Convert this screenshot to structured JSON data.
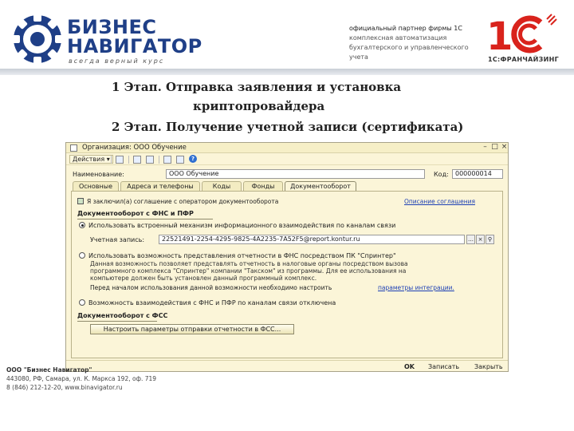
{
  "brand": {
    "line1": "БИЗНЕС",
    "line2": "НАВИГАТОР",
    "tagline": "всегда верный курс",
    "partner_lines": [
      "официальный партнер фирмы 1С",
      "комплексная автоматизация",
      "бухгалтерского и управленческого учета"
    ],
    "franchise": "1С:ФРАНЧАЙЗИНГ",
    "colors": {
      "brand_blue": "#1f3f87",
      "one_c_red": "#d9231c"
    }
  },
  "titles": {
    "step1_line1": "1 Этап. Отправка заявления и установка",
    "step1_line2": "криптопровайдера",
    "step2": "2 Этап. Получение учетной записи (сертификата)"
  },
  "window": {
    "title": "Организация: ООО Обучение",
    "toolbar": {
      "actions": "Действия ▾"
    },
    "name_label": "Наименование:",
    "name_value": "ООО Обучение",
    "code_label": "Код:",
    "code_value": "000000014",
    "tabs": [
      "Основные",
      "Адреса и телефоны",
      "Коды",
      "Фонды",
      "Документооборот"
    ],
    "active_tab": 4,
    "exchange_checkbox": "Я заключил(а) соглашение с оператором документооборота",
    "exchange_link": "Описание соглашения",
    "section_fns": "Документооборот с ФНС и ПФР",
    "radio_builtin": "Использовать встроенный механизм информационного взаимодействия по каналам связи",
    "account_label": "Учетная запись:",
    "account_value": "22521491-2254-4295-9825-4A2235-7A52F5@report.kontur.ru",
    "radio_spinter": "Использовать возможность представления отчетности в ФНС посредством ПК \"Спринтер\"",
    "spinter_desc_lines": [
      "Данная возможность позволяет представлять отчетность в налоговые органы посредством вызова",
      "программного комплекса \"Спринтер\" компании \"Такском\" из программы. Для ее использования на",
      "компьютере должен быть установлен данный программный комплекс."
    ],
    "before_text": "Перед началом использования данной возможности необходимо настроить",
    "integration_link": "параметры интеграции.",
    "radio_off": "Возможность взаимодействия с ФНС и ПФР по каналам связи отключена",
    "section_fss": "Документооборот с ФСС",
    "fss_button": "Настроить параметры отправки отчетности в ФСС...",
    "btn_ok": "OK",
    "btn_save": "Записать",
    "btn_close": "Закрыть"
  },
  "footer": {
    "company": "ООО \"Бизнес Навигатор\"",
    "address": "443080, РФ, Самара, ул. К. Маркса 192, оф. 719",
    "contacts": "8 (846) 212-12-20, www.binavigator.ru"
  }
}
